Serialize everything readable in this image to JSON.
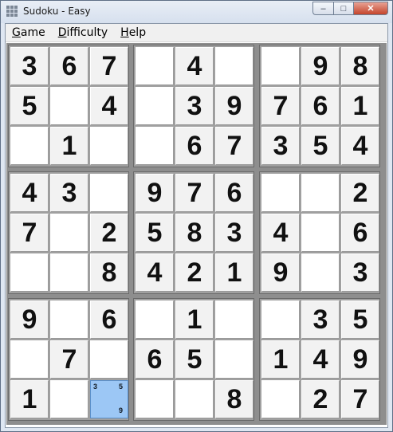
{
  "window": {
    "title": "Sudoku - Easy",
    "buttons": {
      "minimize": "–",
      "maximize": "□",
      "close": "✕"
    }
  },
  "menu": [
    {
      "label": "Game"
    },
    {
      "label": "Difficulty"
    },
    {
      "label": "Help"
    }
  ],
  "grid": [
    [
      "3",
      "6",
      "7",
      "",
      "4",
      "",
      "",
      "9",
      "8"
    ],
    [
      "5",
      "",
      "4",
      "",
      "3",
      "9",
      "7",
      "6",
      "1"
    ],
    [
      "",
      "1",
      "",
      "",
      "6",
      "7",
      "3",
      "5",
      "4"
    ],
    [
      "4",
      "3",
      "",
      "9",
      "7",
      "6",
      "",
      "",
      "2"
    ],
    [
      "7",
      "",
      "2",
      "5",
      "8",
      "3",
      "4",
      "",
      "6"
    ],
    [
      "",
      "",
      "8",
      "4",
      "2",
      "1",
      "9",
      "",
      "3"
    ],
    [
      "9",
      "",
      "6",
      "",
      "1",
      "",
      "",
      "3",
      "5"
    ],
    [
      "",
      "7",
      "",
      "6",
      "5",
      "",
      "1",
      "4",
      "9"
    ],
    [
      "1",
      "",
      "",
      "",
      "",
      "8",
      "",
      "2",
      "7"
    ]
  ],
  "selected_cell": {
    "row": 9,
    "col": 3,
    "pencil_marks": [
      "3",
      "5",
      "9"
    ]
  },
  "colors": {
    "selected_cell": "#9cc7f5",
    "given_cell": "#f2f2f2",
    "empty_cell": "#ffffff"
  }
}
